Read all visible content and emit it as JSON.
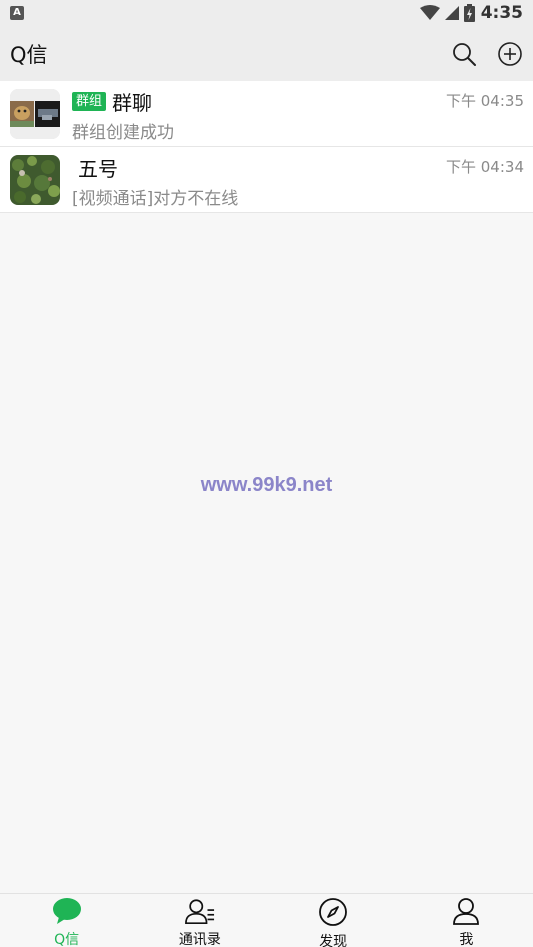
{
  "status_bar": {
    "notification_letter": "A",
    "time": "4:35"
  },
  "header": {
    "title": "Q信"
  },
  "chats": [
    {
      "tag": "群组",
      "name": "群聊",
      "preview": "群组创建成功",
      "time": "下午 04:35"
    },
    {
      "name": "五号",
      "preview": "[视频通话]对方不在线",
      "time": "下午 04:34"
    }
  ],
  "watermark": "www.99k9.net",
  "bottom_nav": {
    "items": [
      {
        "label": "Q信",
        "active": true
      },
      {
        "label": "通讯录"
      },
      {
        "label": "发现"
      },
      {
        "label": "我"
      }
    ]
  },
  "colors": {
    "accent_green": "#1fb455",
    "header_bg": "#ededed",
    "page_bg": "#f7f7f7"
  }
}
